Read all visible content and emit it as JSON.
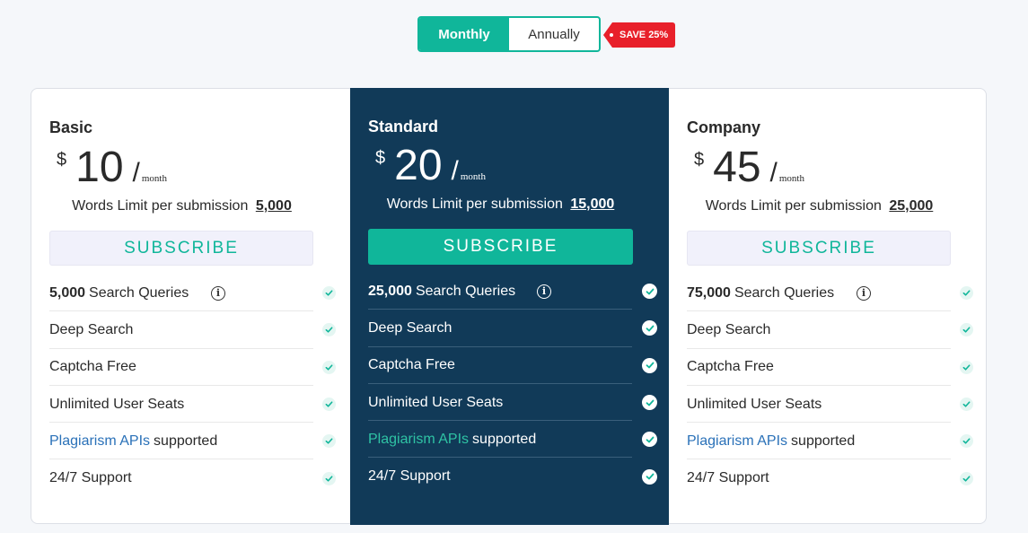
{
  "billing_toggle": {
    "monthly_label": "Monthly",
    "annually_label": "Annually",
    "selected": "Monthly",
    "save_badge": "SAVE 25%"
  },
  "colors": {
    "accent": "#10b69a",
    "highlight_card_bg": "#113a58",
    "badge_red": "#e8202a",
    "link_blue": "#2a71b8"
  },
  "plans": [
    {
      "name": "Basic",
      "currency": "$",
      "price": "10",
      "slash": "/",
      "period": "month",
      "words_label": "Words Limit per submission",
      "words_limit": "5,000",
      "subscribe_label": "SUBSCRIBE",
      "features": {
        "queries_count": "5,000",
        "queries_label": "Search Queries",
        "deep_search": "Deep Search",
        "captcha": "Captcha Free",
        "seats": "Unlimited User Seats",
        "api_link": "Plagiarism APIs",
        "api_suffix": "supported",
        "support": "24/7 Support"
      }
    },
    {
      "name": "Standard",
      "currency": "$",
      "price": "20",
      "slash": "/",
      "period": "month",
      "words_label": "Words Limit per submission",
      "words_limit": "15,000",
      "subscribe_label": "SUBSCRIBE",
      "features": {
        "queries_count": "25,000",
        "queries_label": "Search Queries",
        "deep_search": "Deep Search",
        "captcha": "Captcha Free",
        "seats": "Unlimited User Seats",
        "api_link": "Plagiarism APIs",
        "api_suffix": "supported",
        "support": "24/7 Support"
      }
    },
    {
      "name": "Company",
      "currency": "$",
      "price": "45",
      "slash": "/",
      "period": "month",
      "words_label": "Words Limit per submission",
      "words_limit": "25,000",
      "subscribe_label": "SUBSCRIBE",
      "features": {
        "queries_count": "75,000",
        "queries_label": "Search Queries",
        "deep_search": "Deep Search",
        "captcha": "Captcha Free",
        "seats": "Unlimited User Seats",
        "api_link": "Plagiarism APIs",
        "api_suffix": "supported",
        "support": "24/7 Support"
      }
    }
  ],
  "icons": {
    "info": "info-circle-icon",
    "check": "check-circle-icon"
  }
}
